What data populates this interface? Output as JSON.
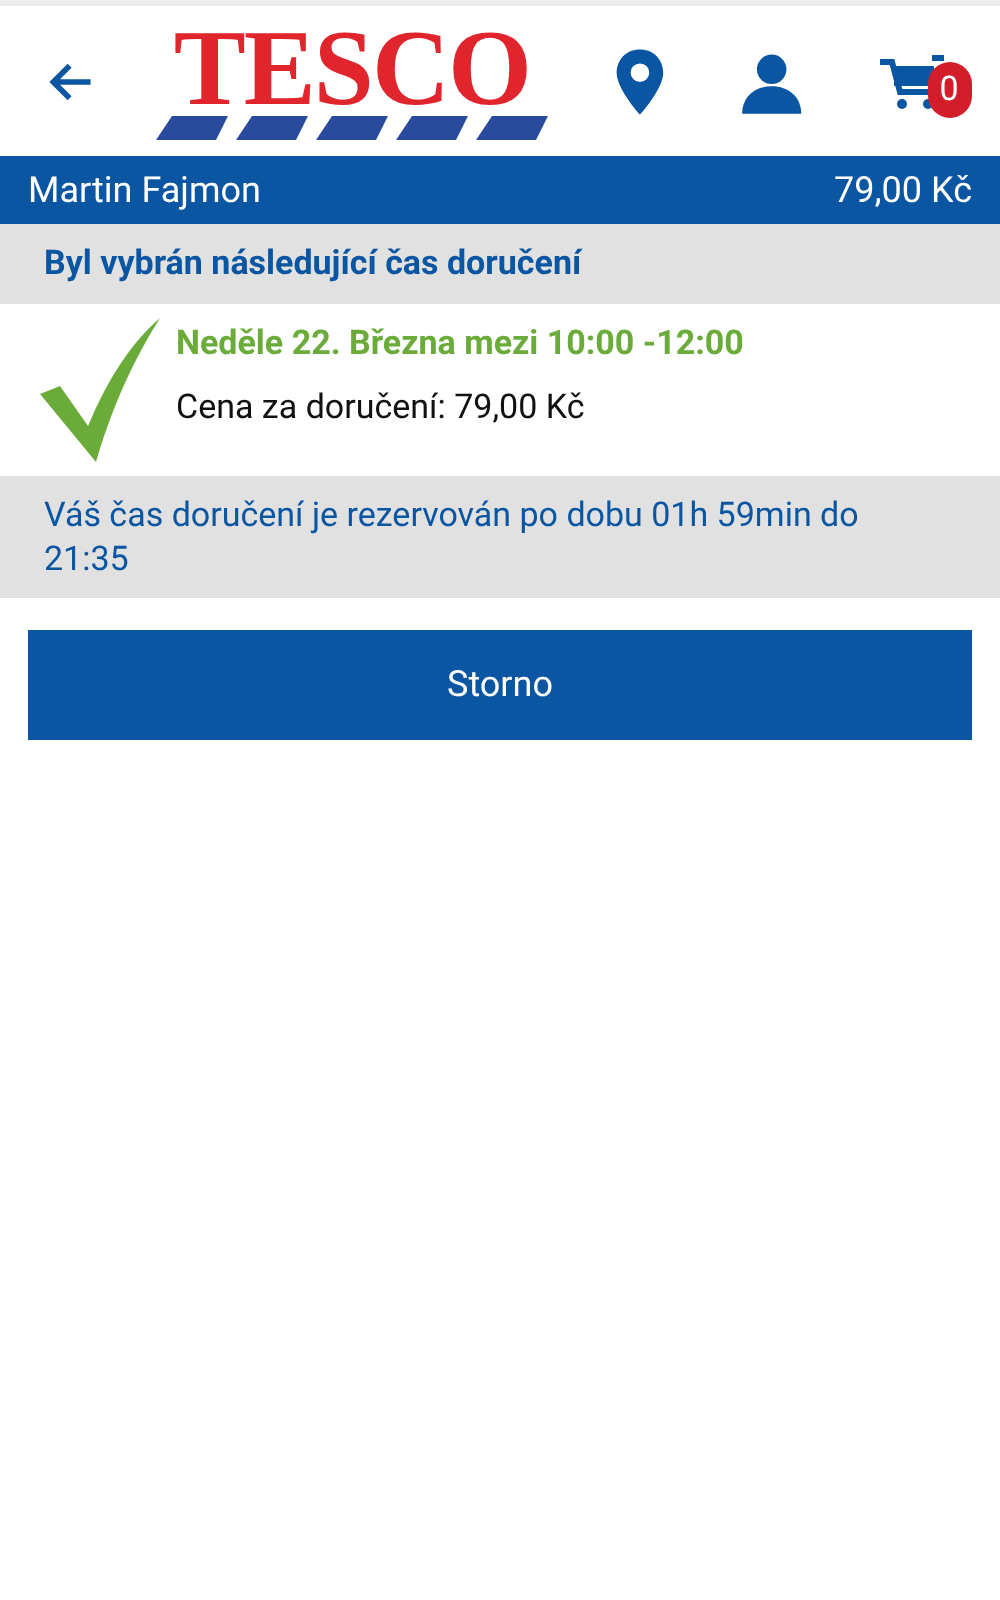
{
  "header": {
    "logo": "TESCO",
    "cart_count": "0"
  },
  "account_bar": {
    "name": "Martin Fajmon",
    "total": "79,00 Kč"
  },
  "selected_heading": "Byl vybrán následující čas doručení",
  "slot": {
    "time": "Neděle 22. Března mezi 10:00 -12:00",
    "price": "Cena za doručení: 79,00 Kč"
  },
  "reservation_note": "Váš čas doručení je rezervován po dobu 01h 59min do 21:35",
  "buttons": [
    "Storno"
  ]
}
